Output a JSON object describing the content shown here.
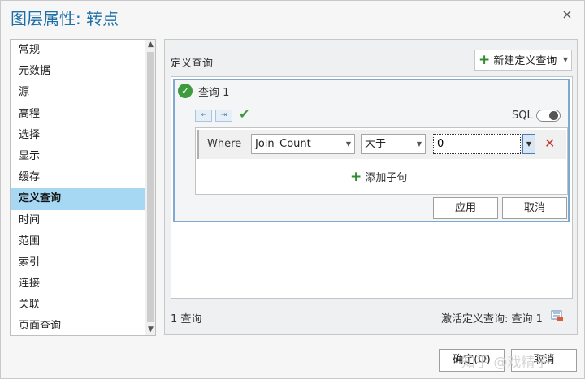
{
  "window": {
    "title": "图层属性: 转点",
    "close_glyph": "×"
  },
  "sidebar": {
    "items": [
      {
        "label": "常规"
      },
      {
        "label": "元数据"
      },
      {
        "label": "源"
      },
      {
        "label": "高程"
      },
      {
        "label": "选择"
      },
      {
        "label": "显示"
      },
      {
        "label": "缓存"
      },
      {
        "label": "定义查询",
        "active": true
      },
      {
        "label": "时间"
      },
      {
        "label": "范围"
      },
      {
        "label": "索引"
      },
      {
        "label": "连接"
      },
      {
        "label": "关联"
      },
      {
        "label": "页面查询"
      }
    ]
  },
  "main": {
    "section_title": "定义查询",
    "new_query_button": "新建定义查询",
    "query": {
      "title": "查询 1",
      "sql_label": "SQL",
      "sql_enabled": false,
      "clause": {
        "where_label": "Where",
        "field": "Join_Count",
        "operator": "大于",
        "value": "0"
      },
      "add_clause_label": "添加子句",
      "apply_label": "应用",
      "cancel_label": "取消"
    },
    "footer": {
      "count_text": "1 查询",
      "active_text": "激活定义查询: 查询 1"
    }
  },
  "dialog_buttons": {
    "ok": "确定(O)",
    "cancel": "取消"
  },
  "watermark": "知乎 @戏精子",
  "colors": {
    "title": "#1d6fa6",
    "selected": "#a6d8f4",
    "accent_green": "#3d9a3d",
    "remove_red": "#c0392b"
  },
  "icons": {
    "close": "close-icon",
    "plus": "plus-icon",
    "check": "check-circle-icon",
    "remove": "remove-icon",
    "toggle": "toggle-icon",
    "layers": "layer-filter-icon"
  }
}
